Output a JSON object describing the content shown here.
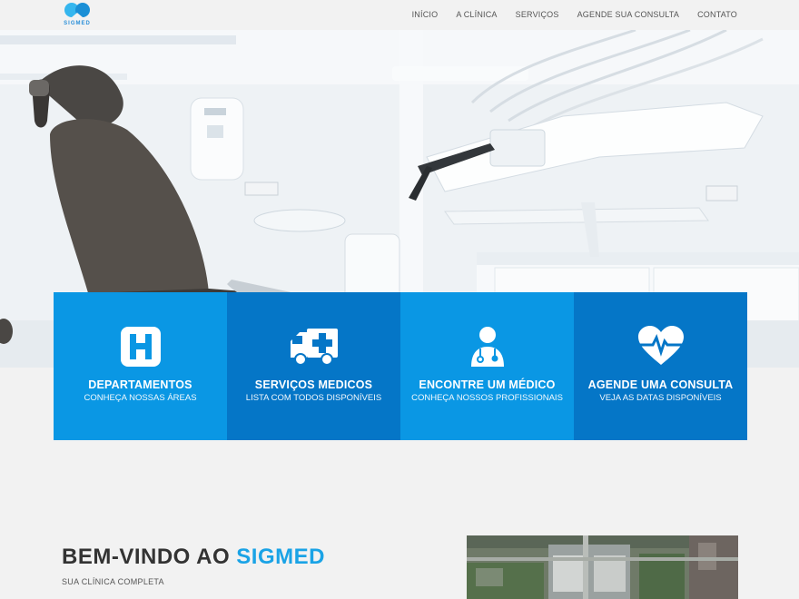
{
  "logo": {
    "text": "SIGMED"
  },
  "nav": {
    "items": [
      "INÍCIO",
      "A CLÍNICA",
      "SERVIÇOS",
      "AGENDE SUA CONSULTA",
      "CONTATO"
    ]
  },
  "hero": {
    "image": "dental-office-photo"
  },
  "tiles": [
    {
      "title": "DEPARTAMENTOS",
      "subtitle": "CONHEÇA NOSSAS ÁREAS",
      "icon": "hospital-icon",
      "color": "#0a97e4"
    },
    {
      "title": "SERVIÇOS MEDICOS",
      "subtitle": "LISTA COM TODOS DISPONÍVEIS",
      "icon": "ambulance-icon",
      "color": "#0576c7"
    },
    {
      "title": "ENCONTRE UM MÉDICO",
      "subtitle": "CONHEÇA NOSSOS PROFISSIONAIS",
      "icon": "doctor-icon",
      "color": "#0a97e4"
    },
    {
      "title": "AGENDE UMA CONSULTA",
      "subtitle": "VEJA AS DATAS DISPONÍVEIS",
      "icon": "heartbeat-icon",
      "color": "#0576c7"
    }
  ],
  "welcome": {
    "title_prefix": "BEM-VINDO AO ",
    "title_brand": "SIGMED",
    "subtitle": "SUA CLÍNICA COMPLETA"
  },
  "colors": {
    "accent": "#1aa3e6",
    "tile_light": "#0a97e4",
    "tile_dark": "#0576c7"
  }
}
